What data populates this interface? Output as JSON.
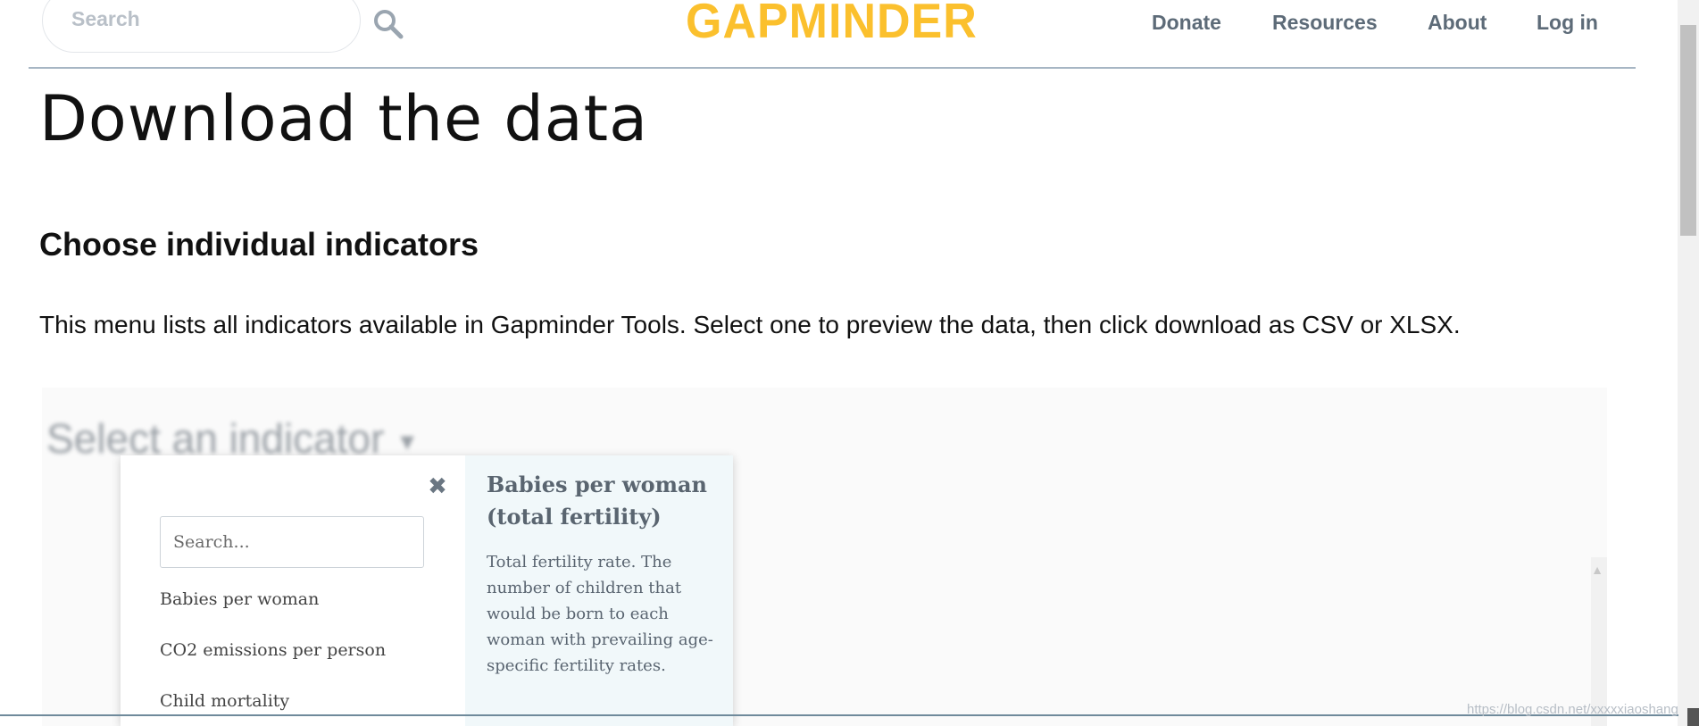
{
  "header": {
    "search_placeholder": "Search",
    "logo_text": "GAPMINDER",
    "nav": [
      "Donate",
      "Resources",
      "About",
      "Log in"
    ]
  },
  "main": {
    "title": "Download the data",
    "section_title": "Choose individual indicators",
    "intro": "This menu lists all indicators available in Gapminder Tools. Select one to preview the data, then click download as CSV or XLSX.",
    "select_label": "Select an indicator"
  },
  "popup": {
    "search_placeholder": "Search...",
    "items": [
      "Babies per woman",
      "CO2 emissions per person",
      "Child mortality"
    ],
    "detail": {
      "title": "Babies per woman (total fertility)",
      "description": "Total fertility rate. The number of children that would be born to each woman with prevailing age-specific fertility rates."
    }
  },
  "footer": {
    "watermark": "https://blog.csdn.net/xxxxxiaoshang"
  },
  "colors": {
    "logo": "#fbc02d",
    "nav": "#5d6b78",
    "detail_bg": "#f1f8fa"
  }
}
